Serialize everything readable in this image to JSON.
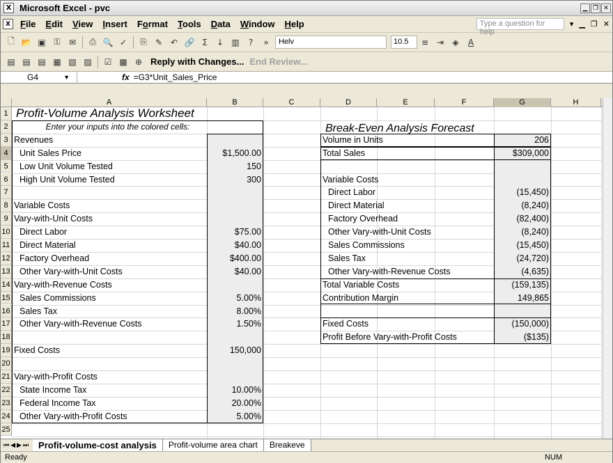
{
  "window": {
    "title": "Microsoft Excel - pvc",
    "app_icon": "excel-icon"
  },
  "menu": {
    "items": [
      {
        "label": "File",
        "u": "F",
        "rest": "ile"
      },
      {
        "label": "Edit",
        "u": "E",
        "rest": "dit"
      },
      {
        "label": "View",
        "u": "V",
        "rest": "iew"
      },
      {
        "label": "Insert",
        "u": "I",
        "rest": "nsert"
      },
      {
        "label": "Format",
        "u": "o",
        "rest": "rmat"
      },
      {
        "label": "Tools",
        "u": "T",
        "rest": "ools"
      },
      {
        "label": "Data",
        "u": "D",
        "rest": "ata"
      },
      {
        "label": "Window",
        "u": "W",
        "rest": "indow"
      },
      {
        "label": "Help",
        "u": "H",
        "rest": "elp"
      }
    ],
    "help_placeholder": "Type a question for help"
  },
  "toolbar": {
    "font": "Helv",
    "size": "10.5"
  },
  "reviewbar": {
    "reply": "Reply with Changes...",
    "end": "End Review..."
  },
  "formula_bar": {
    "cell": "G4",
    "fx": "fx",
    "formula": "=G3*Unit_Sales_Price"
  },
  "columns": [
    "A",
    "B",
    "C",
    "D",
    "E",
    "F",
    "G",
    "H"
  ],
  "rows": [
    "1",
    "2",
    "3",
    "4",
    "5",
    "6",
    "7",
    "8",
    "9",
    "10",
    "11",
    "12",
    "13",
    "14",
    "15",
    "16",
    "17",
    "18",
    "19",
    "20",
    "21",
    "22",
    "23",
    "24",
    "25"
  ],
  "sheet": {
    "title": "Profit-Volume Analysis Worksheet",
    "note": "Enter your inputs into the colored cells:",
    "left": [
      {
        "row": 3,
        "label": "Revenues",
        "indent": 0,
        "value": ""
      },
      {
        "row": 4,
        "label": "Unit Sales Price",
        "indent": 1,
        "value": "$1,500.00"
      },
      {
        "row": 5,
        "label": "Low Unit Volume Tested",
        "indent": 1,
        "value": "150"
      },
      {
        "row": 6,
        "label": "High Unit Volume Tested",
        "indent": 1,
        "value": "300"
      },
      {
        "row": 8,
        "label": "Variable Costs",
        "indent": 0,
        "value": ""
      },
      {
        "row": 9,
        "label": "Vary-with-Unit Costs",
        "indent": 0,
        "value": ""
      },
      {
        "row": 10,
        "label": "Direct Labor",
        "indent": 1,
        "value": "$75.00"
      },
      {
        "row": 11,
        "label": "Direct Material",
        "indent": 1,
        "value": "$40.00"
      },
      {
        "row": 12,
        "label": "Factory Overhead",
        "indent": 1,
        "value": "$400.00"
      },
      {
        "row": 13,
        "label": "Other Vary-with-Unit Costs",
        "indent": 1,
        "value": "$40.00"
      },
      {
        "row": 14,
        "label": "Vary-with-Revenue Costs",
        "indent": 0,
        "value": ""
      },
      {
        "row": 15,
        "label": "Sales Commissions",
        "indent": 1,
        "value": "5.00%"
      },
      {
        "row": 16,
        "label": "Sales Tax",
        "indent": 1,
        "value": "8.00%"
      },
      {
        "row": 17,
        "label": "Other Vary-with-Revenue Costs",
        "indent": 1,
        "value": "1.50%"
      },
      {
        "row": 19,
        "label": "Fixed Costs",
        "indent": 0,
        "value": "150,000"
      },
      {
        "row": 21,
        "label": "Vary-with-Profit Costs",
        "indent": 0,
        "value": ""
      },
      {
        "row": 22,
        "label": "State Income Tax",
        "indent": 1,
        "value": "10.00%"
      },
      {
        "row": 23,
        "label": "Federal Income Tax",
        "indent": 1,
        "value": "20.00%"
      },
      {
        "row": 24,
        "label": "Other Vary-with-Profit Costs",
        "indent": 1,
        "value": "5.00%"
      }
    ],
    "forecast_title": "Break-Even Analysis Forecast",
    "right": [
      {
        "row": 3,
        "label": "Volume in Units",
        "indent": 0,
        "value": "206"
      },
      {
        "row": 4,
        "label": "Total Sales",
        "indent": 0,
        "value": "$309,000"
      },
      {
        "row": 6,
        "label": "Variable Costs",
        "indent": 0,
        "value": ""
      },
      {
        "row": 7,
        "label": "Direct Labor",
        "indent": 1,
        "value": "(15,450)"
      },
      {
        "row": 8,
        "label": "Direct Material",
        "indent": 1,
        "value": "(8,240)"
      },
      {
        "row": 9,
        "label": "Factory Overhead",
        "indent": 1,
        "value": "(82,400)"
      },
      {
        "row": 10,
        "label": "Other Vary-with-Unit Costs",
        "indent": 1,
        "value": "(8,240)"
      },
      {
        "row": 11,
        "label": "Sales Commissions",
        "indent": 1,
        "value": "(15,450)"
      },
      {
        "row": 12,
        "label": "Sales Tax",
        "indent": 1,
        "value": "(24,720)"
      },
      {
        "row": 13,
        "label": "Other Vary-with-Revenue Costs",
        "indent": 1,
        "value": "(4,635)"
      },
      {
        "row": 14,
        "label": "Total Variable Costs",
        "indent": 0,
        "value": "(159,135)"
      },
      {
        "row": 15,
        "label": "Contribution Margin",
        "indent": 0,
        "value": "149,865"
      },
      {
        "row": 17,
        "label": "Fixed Costs",
        "indent": 0,
        "value": "(150,000)"
      },
      {
        "row": 18,
        "label": "Profit Before Vary-with-Profit Costs",
        "indent": 0,
        "value": "($135)"
      }
    ]
  },
  "tabs": [
    "Profit-volume-cost analysis",
    "Profit-volume area chart",
    "Breakeve"
  ],
  "status": {
    "left": "Ready",
    "num": "NUM"
  }
}
